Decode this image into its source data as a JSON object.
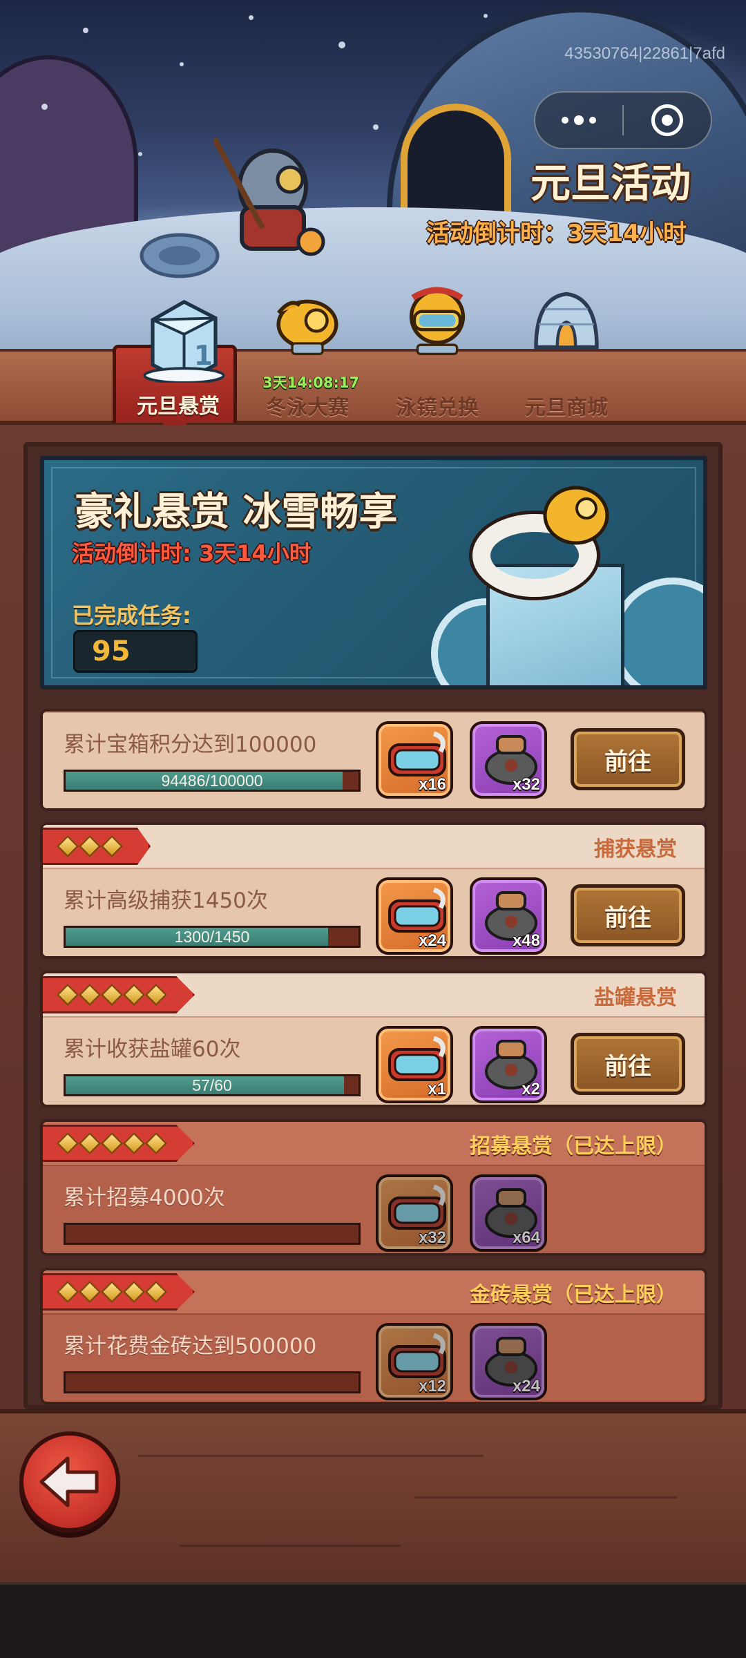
{
  "header": {
    "watermark": "43530764|22861|7afd",
    "event_title": "元旦活动",
    "event_countdown": "活动倒计时：3天14小时",
    "menu_icon": "more-dots-icon",
    "close_icon": "target-circle-icon"
  },
  "tabs": [
    {
      "label": "元旦悬赏",
      "icon": "ice-cube-icon",
      "active": true
    },
    {
      "label": "冬泳大赛",
      "icon": "golden-fish-icon",
      "active": false,
      "timer": "3天14:08:17"
    },
    {
      "label": "泳镜兑换",
      "icon": "swim-goggles-icon",
      "active": false
    },
    {
      "label": "元旦商城",
      "icon": "igloo-shop-icon",
      "active": false
    }
  ],
  "banner": {
    "title": "豪礼悬赏 冰雪畅享",
    "countdown": "活动倒计时: 3天14小时",
    "completed_label": "已完成任务:",
    "completed_value": "95"
  },
  "tasks": [
    {
      "category": "",
      "stars": 0,
      "description": "累计宝箱积分达到100000",
      "progress_text": "94486/100000",
      "progress": 0.94486,
      "rewards": [
        {
          "icon": "goggles-icon",
          "qty": "x16"
        },
        {
          "icon": "salt-jar-icon",
          "qty": "x32"
        }
      ],
      "button": "前往",
      "capped": false
    },
    {
      "category": "捕获悬赏",
      "stars": 3,
      "description": "累计高级捕获1450次",
      "progress_text": "1300/1450",
      "progress": 0.8966,
      "rewards": [
        {
          "icon": "goggles-icon",
          "qty": "x24"
        },
        {
          "icon": "salt-jar-icon",
          "qty": "x48"
        }
      ],
      "button": "前往",
      "capped": false
    },
    {
      "category": "盐罐悬赏",
      "stars": 5,
      "description": "累计收获盐罐60次",
      "progress_text": "57/60",
      "progress": 0.95,
      "rewards": [
        {
          "icon": "goggles-icon",
          "qty": "x1"
        },
        {
          "icon": "salt-jar-icon",
          "qty": "x2"
        }
      ],
      "button": "前往",
      "capped": false
    },
    {
      "category": "招募悬赏（已达上限）",
      "stars": 5,
      "description": "累计招募4000次",
      "progress_text": "",
      "progress": 0,
      "rewards": [
        {
          "icon": "goggles-icon",
          "qty": "x32"
        },
        {
          "icon": "salt-jar-icon",
          "qty": "x64"
        }
      ],
      "button": "",
      "capped": true
    },
    {
      "category": "金砖悬赏（已达上限）",
      "stars": 5,
      "description": "累计花费金砖达到500000",
      "progress_text": "",
      "progress": 0,
      "rewards": [
        {
          "icon": "goggles-icon",
          "qty": "x12"
        },
        {
          "icon": "salt-jar-icon",
          "qty": "x24"
        }
      ],
      "button": "",
      "capped": true
    }
  ],
  "footer": {
    "back_icon": "back-arrow-icon"
  }
}
